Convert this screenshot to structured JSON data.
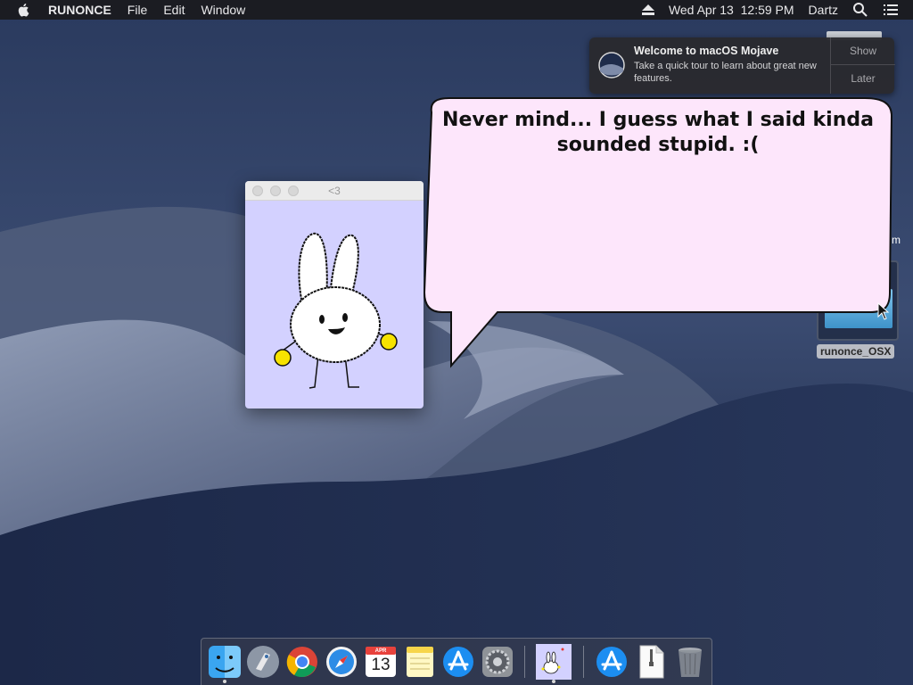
{
  "menubar": {
    "app_name": "RUNONCE",
    "menus": [
      "File",
      "Edit",
      "Window"
    ],
    "clock": "Wed Apr 13  12:59 PM",
    "user": "Dartz"
  },
  "notification": {
    "title": "Welcome to macOS Mojave",
    "body": "Take a quick tour to learn about great new features.",
    "show_label": "Show",
    "later_label": "Later"
  },
  "pet_window": {
    "title": "<3"
  },
  "speech_bubble": {
    "text": "Never mind... I guess what I said kinda sounded stupid. :("
  },
  "desktop": {
    "icon_label": "runonce_OSX",
    "partial_label": "m"
  },
  "dock": {
    "calendar_month": "APR",
    "calendar_day": "13",
    "items": [
      "finder-icon",
      "launchpad-icon",
      "chrome-icon",
      "safari-icon",
      "calendar-icon",
      "notes-icon",
      "app-store-icon",
      "system-preferences-icon",
      "runonce-pet-icon",
      "app-store-downloads-icon",
      "zip-file-icon",
      "trash-icon"
    ]
  },
  "colors": {
    "bubble_fill": "#fde6fb",
    "pet_bg": "#d3d1ff",
    "menubar_bg": "#1b1c22"
  }
}
